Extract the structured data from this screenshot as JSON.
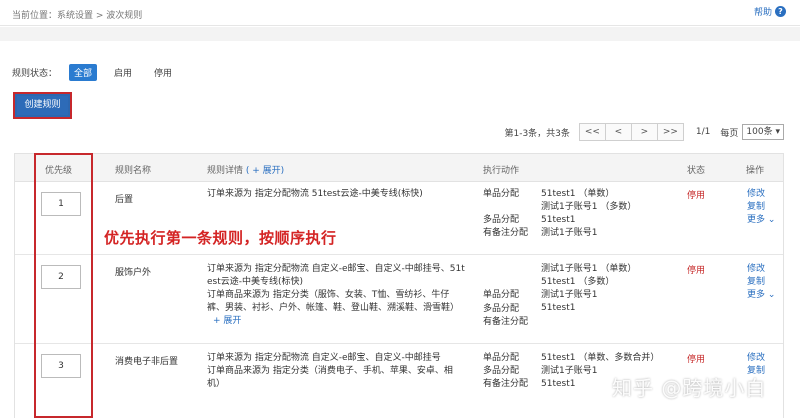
{
  "header": {
    "breadcrumb": "当前位置：系统设置 > 波次规则",
    "help_label": "帮助",
    "help_icon": "?"
  },
  "filter": {
    "label": "规则状态：",
    "options": [
      "全部",
      "启用",
      "停用"
    ],
    "active": "全部"
  },
  "toolbar": {
    "create_label": "创建规则"
  },
  "pagination": {
    "info": "第1-3条，共3条",
    "first": "<<",
    "prev": "<",
    "next": ">",
    "last": ">>",
    "page": "1/1",
    "per_page_label": "每页",
    "per_page_value": "100条"
  },
  "table": {
    "headers": {
      "priority": "优先级",
      "name": "规则名称",
      "detail": "规则详情",
      "detail_expand": "( + 展开)",
      "action": "执行动作",
      "status": "状态",
      "ops": "操作"
    },
    "rows": [
      {
        "priority": "1",
        "name": "后置",
        "detail": [
          "订单来源为 指定分配物流 51test云途-中美专线(标快)"
        ],
        "actions": [
          {
            "label": "单品分配",
            "value": "51test1 （单数）"
          },
          {
            "label": "",
            "value": "测试1子账号1 （多数）"
          },
          {
            "label": "多品分配",
            "value": "51test1"
          },
          {
            "label": "有备注分配",
            "value": "测试1子账号1"
          }
        ],
        "status": "停用",
        "ops": [
          "修改",
          "复制",
          "更多"
        ]
      },
      {
        "priority": "2",
        "name": "服饰户外",
        "detail": [
          "订单来源为 指定分配物流 自定义-e邮宝、自定义-中邮挂号、51t",
          "est云途-中美专线(标快)",
          "订单商品来源为 指定分类（服饰、女装、T恤、雪纺衫、牛仔",
          "裤、男装、衬衫、户外、帐篷、鞋、登山鞋、溯溪鞋、滑雪鞋）"
        ],
        "detail_expand": "+ 展开",
        "actions": [
          {
            "label": "单品分配",
            "value": "测试1子账号1 （单数）"
          },
          {
            "label": "",
            "value": "51test1 （多数）"
          },
          {
            "label": "多品分配",
            "value": "测试1子账号1"
          },
          {
            "label": "有备注分配",
            "value": "51test1"
          }
        ],
        "status": "停用",
        "ops": [
          "修改",
          "复制",
          "更多"
        ]
      },
      {
        "priority": "3",
        "name": "消费电子非后置",
        "detail": [
          "订单来源为 指定分配物流 自定义-e邮宝、自定义-中邮挂号",
          "订单商品来源为 指定分类（消费电子、手机、苹果、安卓、相",
          "机）"
        ],
        "actions": [
          {
            "label": "单品分配",
            "value": "51test1 （单数、多数合并）"
          },
          {
            "label": "多品分配",
            "value": "测试1子账号1"
          },
          {
            "label": "有备注分配",
            "value": "51test1"
          }
        ],
        "status": "停用",
        "ops": [
          "修改",
          "复制"
        ]
      }
    ]
  },
  "annotation": "优先执行第一条规则，按顺序执行",
  "watermark": "知乎 @跨境小白",
  "colors": {
    "accent": "#2a6fc0",
    "annotation_red": "#c7282c",
    "button_blue": "#2c67b0",
    "status_red": "#c62828"
  }
}
